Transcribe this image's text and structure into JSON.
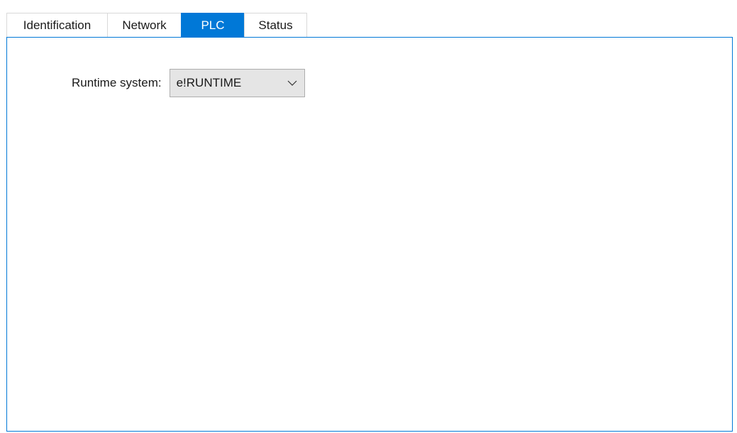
{
  "tabs": [
    {
      "label": "Identification",
      "active": false
    },
    {
      "label": "Network",
      "active": false
    },
    {
      "label": "PLC",
      "active": true
    },
    {
      "label": "Status",
      "active": false
    }
  ],
  "plc_panel": {
    "runtime_label": "Runtime system:",
    "runtime_value": "e!RUNTIME",
    "dropdown_icon": "chevron-down-icon"
  },
  "colors": {
    "accent": "#0078d7",
    "dropdown_bg": "#e5e5e5",
    "dropdown_border": "#adadad",
    "tab_border": "#d9d9d9"
  }
}
